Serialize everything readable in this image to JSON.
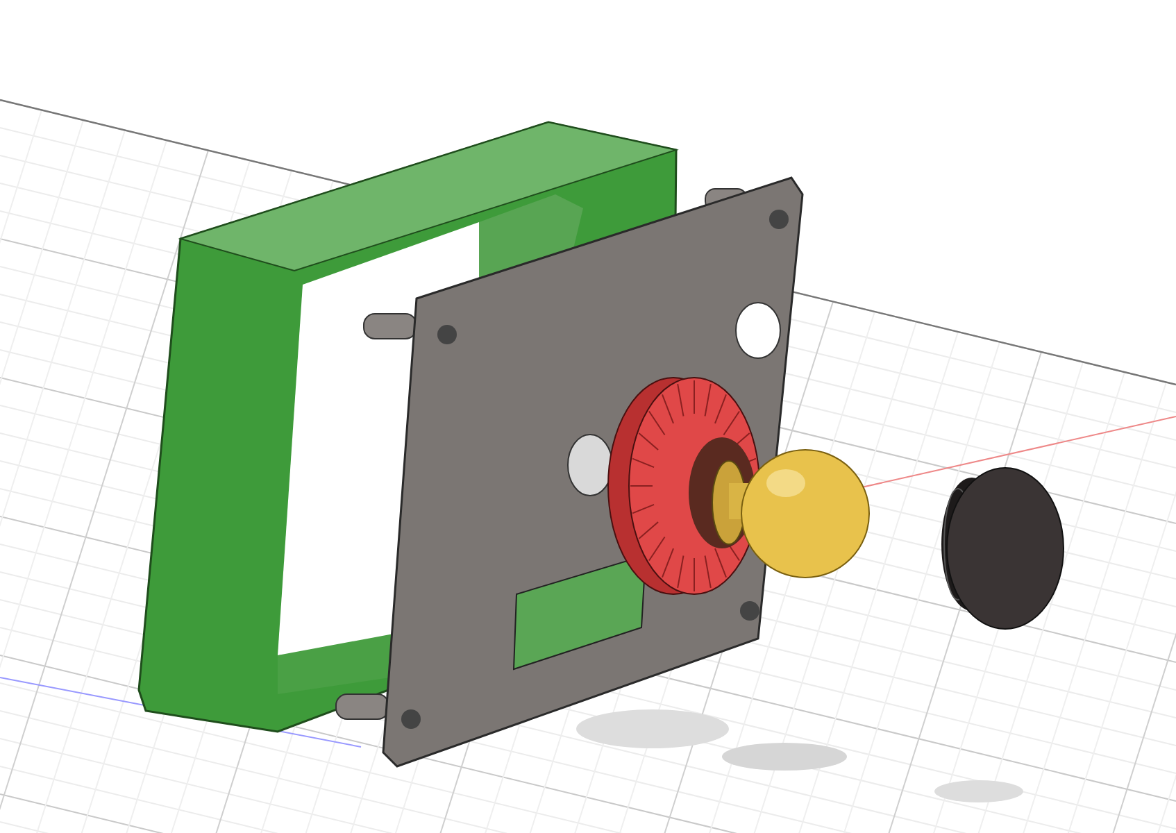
{
  "view": {
    "grid": true
  }
}
